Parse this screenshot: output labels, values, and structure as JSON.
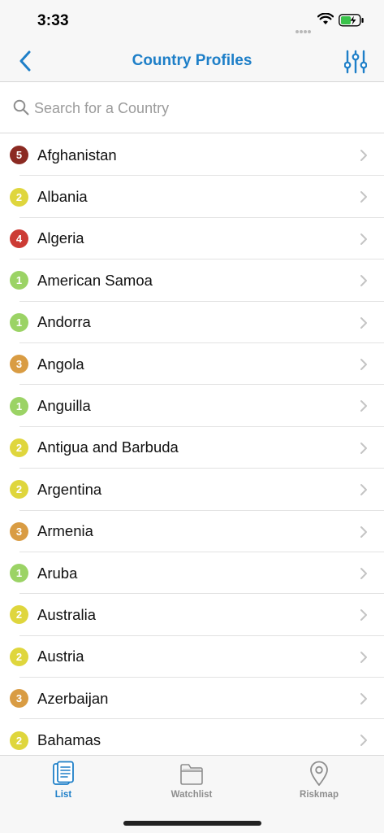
{
  "status": {
    "time": "3:33",
    "battery_color": "#39c24a"
  },
  "nav": {
    "title": "Country Profiles",
    "accent": "#1e7fc8",
    "back_icon": "chevron-left-icon",
    "filter_icon": "sliders-icon"
  },
  "search": {
    "placeholder": "Search for a Country",
    "value": ""
  },
  "risk_colors": {
    "1": "#9bd365",
    "2": "#dfd63d",
    "3": "#d99c43",
    "4": "#cc3b34",
    "5": "#8b2a22"
  },
  "countries": [
    {
      "name": "Afghanistan",
      "level": "5"
    },
    {
      "name": "Albania",
      "level": "2"
    },
    {
      "name": "Algeria",
      "level": "4"
    },
    {
      "name": "American Samoa",
      "level": "1"
    },
    {
      "name": "Andorra",
      "level": "1"
    },
    {
      "name": "Angola",
      "level": "3"
    },
    {
      "name": "Anguilla",
      "level": "1"
    },
    {
      "name": "Antigua and Barbuda",
      "level": "2"
    },
    {
      "name": "Argentina",
      "level": "2"
    },
    {
      "name": "Armenia",
      "level": "3"
    },
    {
      "name": "Aruba",
      "level": "1"
    },
    {
      "name": "Australia",
      "level": "2"
    },
    {
      "name": "Austria",
      "level": "2"
    },
    {
      "name": "Azerbaijan",
      "level": "3"
    },
    {
      "name": "Bahamas",
      "level": "2"
    }
  ],
  "tabs": [
    {
      "label": "List",
      "icon": "list-document-icon",
      "active": true
    },
    {
      "label": "Watchlist",
      "icon": "folder-icon",
      "active": false
    },
    {
      "label": "Riskmap",
      "icon": "map-pin-icon",
      "active": false
    }
  ],
  "tab_colors": {
    "active": "#1e7fc8",
    "inactive": "#8e8e8e"
  }
}
